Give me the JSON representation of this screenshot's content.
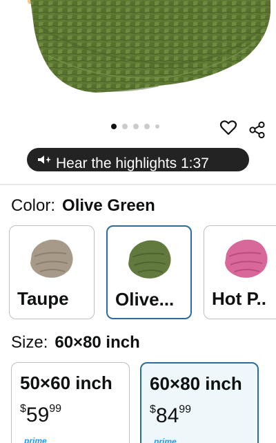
{
  "carousel": {
    "dot_count": 5,
    "active_index": 0
  },
  "audio": {
    "label": "Hear the highlights 1:37"
  },
  "color": {
    "label": "Color:",
    "selected": "Olive Green",
    "options": [
      {
        "name": "Taupe",
        "swatch_color": "#a79a88"
      },
      {
        "name": "Olive...",
        "swatch_color": "#637a3f"
      },
      {
        "name": "Hot P..",
        "swatch_color": "#d8679a"
      }
    ]
  },
  "size": {
    "label": "Size:",
    "selected": "60×80 inch",
    "options": [
      {
        "name": "50×60 inch",
        "currency": "$",
        "whole": "59",
        "fraction": "99",
        "badge": "prime"
      },
      {
        "name": "60×80 inch",
        "currency": "$",
        "whole": "84",
        "fraction": "99",
        "badge": "prime"
      }
    ]
  },
  "colors": {
    "product_green": "#5f7a34",
    "selected_border": "#2b6c9a",
    "prime_blue": "#1a98ff"
  },
  "icons": [
    "wishlist-heart-icon",
    "share-icon",
    "speaker-sparkle-icon"
  ]
}
